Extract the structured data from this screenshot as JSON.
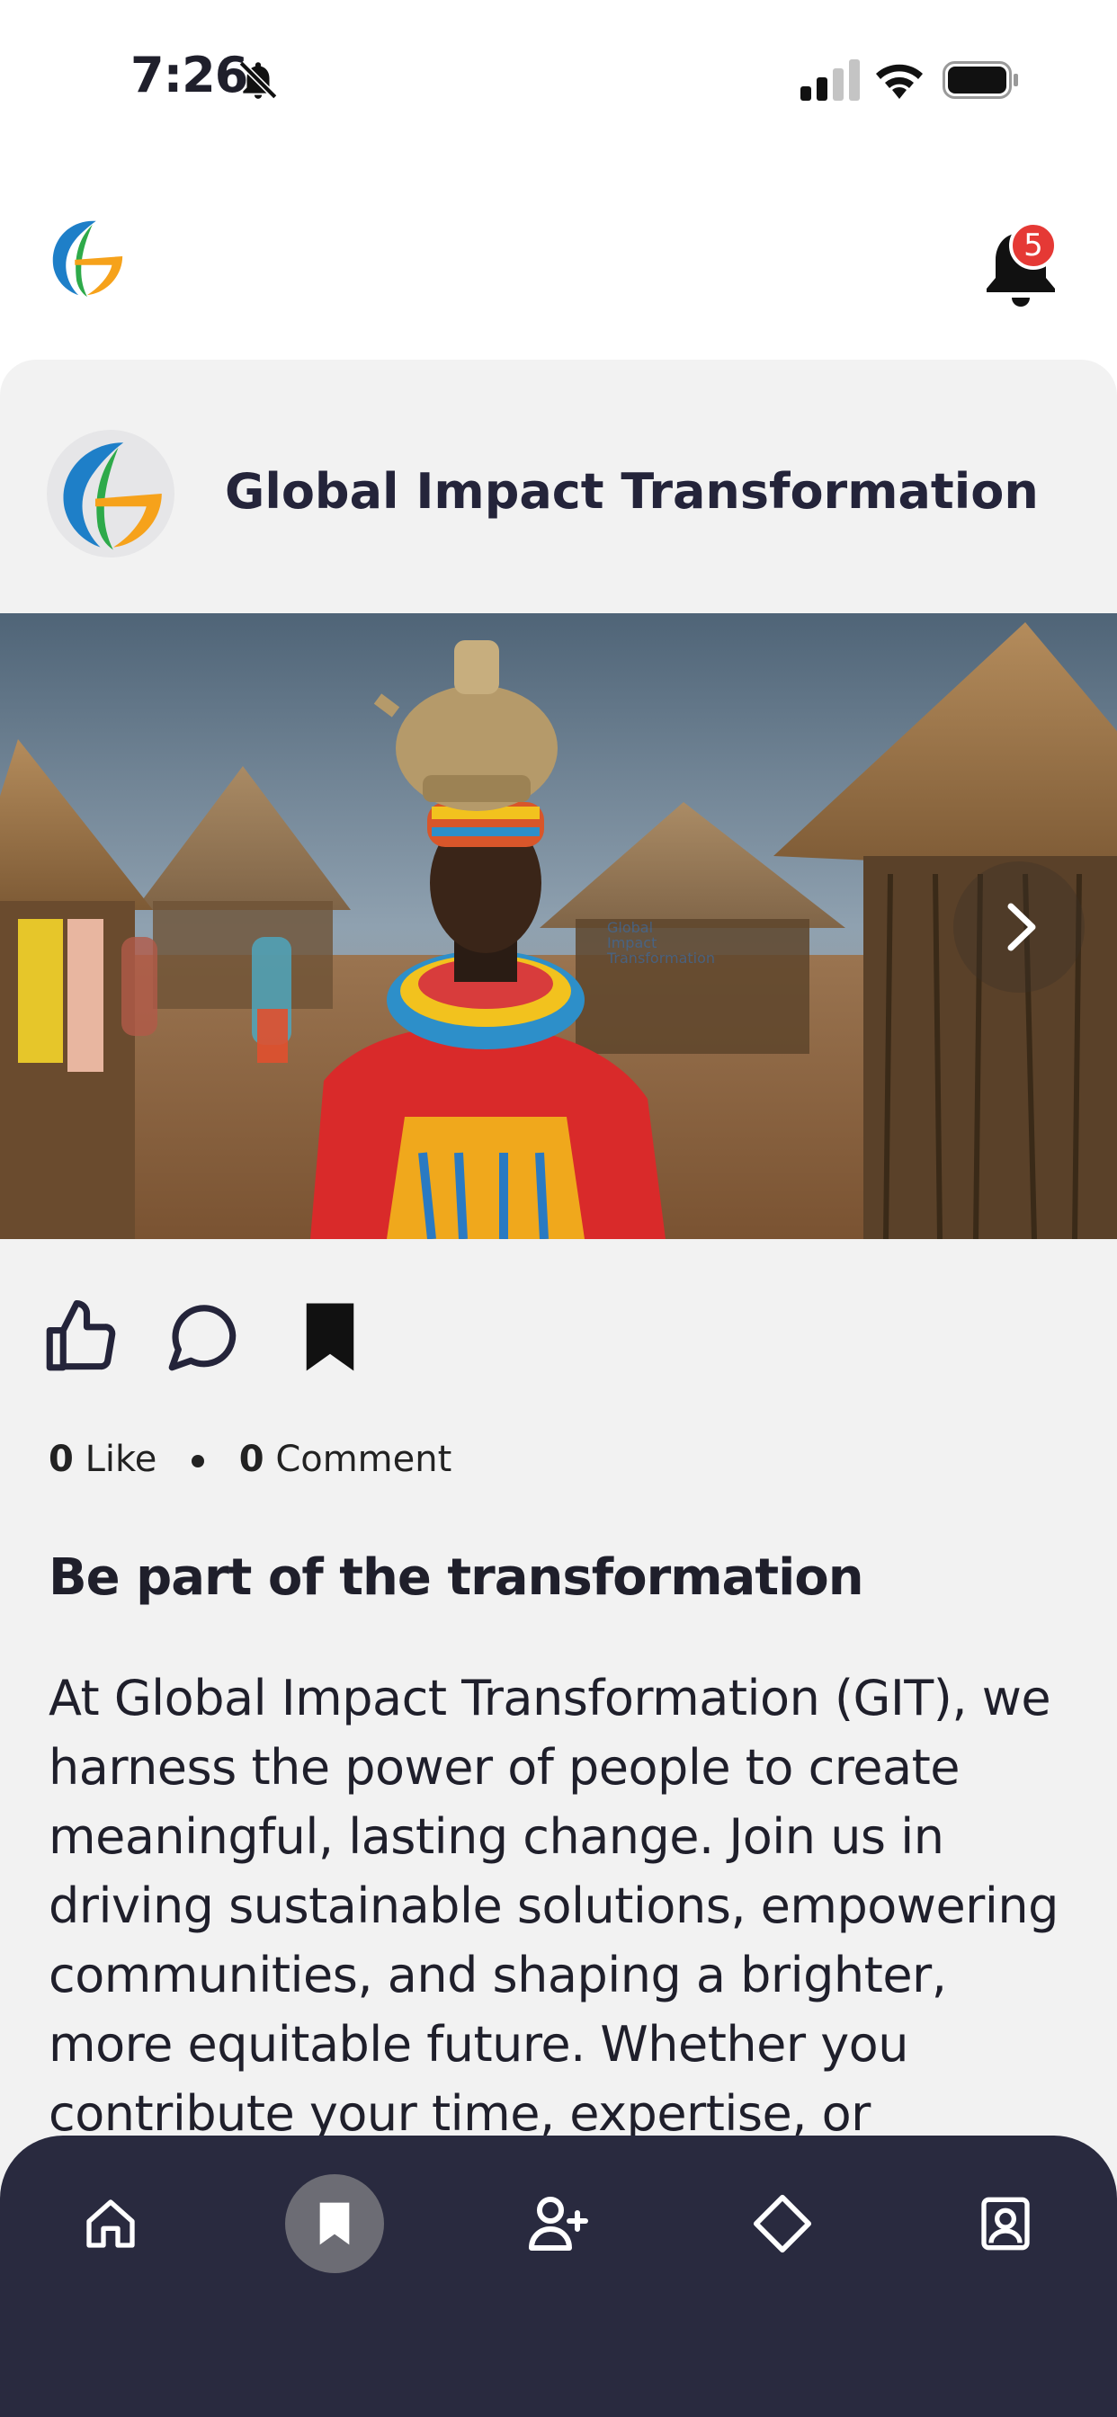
{
  "status_bar": {
    "time": "7:26"
  },
  "header": {
    "notification_count": "5"
  },
  "post": {
    "author": "Global Impact Transformation",
    "likes_count": "0",
    "likes_label": "Like",
    "comments_count": "0",
    "comments_label": "Comment",
    "title": "Be part of the transformation",
    "body": "At Global Impact Transformation (GIT), we harness the power of people to create meaningful, lasting change. Join us in driving sustainable solutions, empowering communities, and shaping a brighter, more equitable future. Whether you contribute your time, expertise, or"
  },
  "bottom_nav": {
    "items": [
      {
        "icon": "home-icon"
      },
      {
        "icon": "bookmark-icon",
        "active": true
      },
      {
        "icon": "add-user-icon"
      },
      {
        "icon": "diamond-icon"
      },
      {
        "icon": "profile-icon"
      }
    ]
  },
  "colors": {
    "nav_background": "#292a3f",
    "badge": "#e53935",
    "card_background": "#f2f2f2"
  }
}
